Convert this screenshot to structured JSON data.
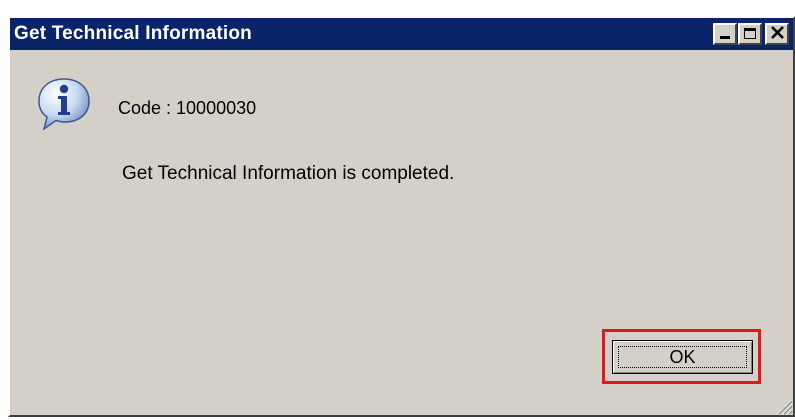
{
  "window": {
    "title": "Get Technical Information",
    "controls": {
      "minimize": "minimize-icon",
      "maximize": "maximize-icon",
      "close": "close-icon",
      "close_glyph": "✕"
    }
  },
  "dialog": {
    "icon": "info-icon",
    "code_line": "Code : 10000030",
    "message": "Get Technical Information is completed.",
    "ok_label": "OK"
  },
  "colors": {
    "titlebar": "#0a246a",
    "window_bg": "#d4d0c8",
    "highlight": "#e8141c"
  }
}
